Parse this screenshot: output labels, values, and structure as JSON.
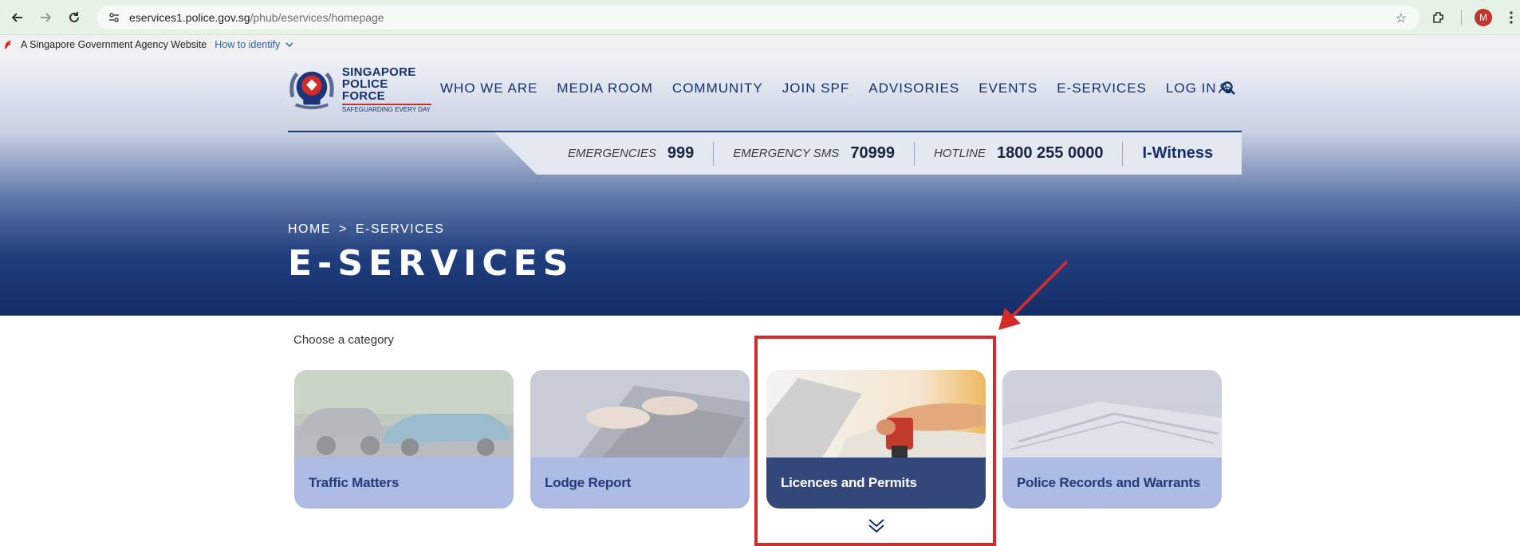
{
  "browser": {
    "url_host": "eservices1.police.gov.sg",
    "url_path": "/phub/eservices/homepage",
    "avatar_letter": "M"
  },
  "gov_banner": {
    "text": "A Singapore Government Agency Website",
    "link": "How to identify"
  },
  "header": {
    "logo": {
      "line1": "SINGAPORE",
      "line2": "POLICE FORCE",
      "tagline": "SAFEGUARDING EVERY DAY"
    },
    "nav": [
      "WHO WE ARE",
      "MEDIA ROOM",
      "COMMUNITY",
      "JOIN SPF",
      "ADVISORIES",
      "EVENTS",
      "E-SERVICES",
      "LOG IN"
    ]
  },
  "info_bar": {
    "emergencies_label": "EMERGENCIES",
    "emergencies_value": "999",
    "sms_label": "EMERGENCY SMS",
    "sms_value": "70999",
    "hotline_label": "HOTLINE",
    "hotline_value": "1800 255 0000",
    "iwitness": "I-Witness"
  },
  "breadcrumb": {
    "home": "HOME",
    "separator": ">",
    "current": "E-SERVICES"
  },
  "page_title": "E-SERVICES",
  "content": {
    "choose_label": "Choose a category",
    "cards": [
      {
        "label": "Traffic Matters",
        "active": false
      },
      {
        "label": "Lodge Report",
        "active": false
      },
      {
        "label": "Licences and Permits",
        "active": true
      },
      {
        "label": "Police Records and Warrants",
        "active": false
      }
    ]
  },
  "colors": {
    "brand_navy": "#14306d",
    "highlight_red": "#d42a2a",
    "card_band_inactive": "#aebbe4",
    "card_band_active": "#33477a"
  }
}
